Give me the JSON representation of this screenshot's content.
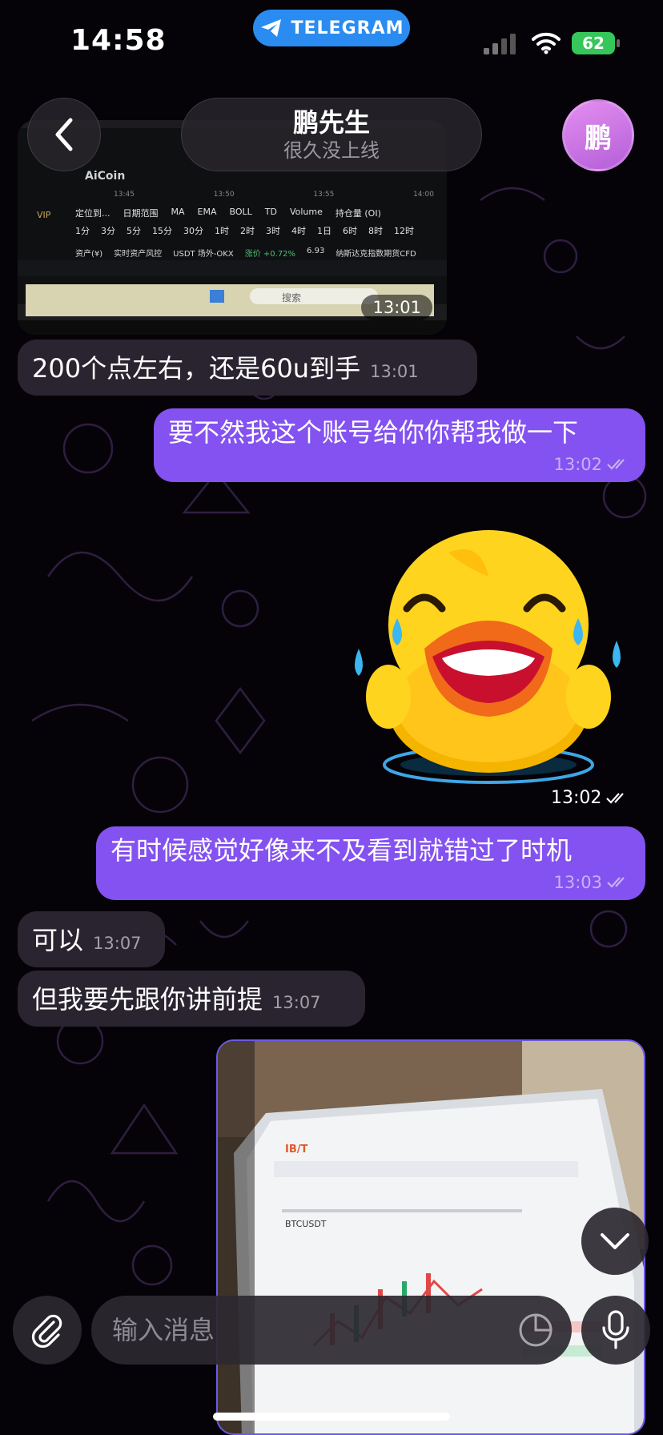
{
  "status_bar": {
    "time": "14:58",
    "app_pill": "TELEGRAM",
    "battery": "62"
  },
  "header": {
    "contact_name": "鹏先生",
    "contact_status": "很久没上线",
    "avatar_initial": "鹏"
  },
  "photo_top": {
    "time": "13:01",
    "screen": {
      "brand": "AiCoin",
      "vip": "VIP",
      "times": [
        "13:45",
        "13:50",
        "13:55",
        "14:00"
      ],
      "toolbar": [
        "定位到...",
        "日期范围",
        "MA",
        "EMA",
        "BOLL",
        "TD",
        "Volume",
        "持仓量 (OI)"
      ],
      "intervals": [
        "1分",
        "3分",
        "5分",
        "15分",
        "30分",
        "1时",
        "2时",
        "3时",
        "4时",
        "1日",
        "6时",
        "8时",
        "12时"
      ],
      "bottom_row": [
        "资产(¥)",
        "实时资产风控",
        "USDT 场外-OKX",
        "涨价 +0.72%",
        "6.93",
        "纳斯达克指数期货CFD"
      ],
      "search": "搜索"
    }
  },
  "messages": [
    {
      "id": "m1",
      "direction": "in",
      "text": "200个点左右，还是60u到手",
      "time": "13:01"
    },
    {
      "id": "m2",
      "direction": "out",
      "text": "要不然我这个账号给你你帮我做一下",
      "time": "13:02"
    },
    {
      "id": "m3",
      "direction": "out",
      "text": "有时候感觉好像来不及看到就错过了时机",
      "time": "13:03"
    },
    {
      "id": "m4",
      "direction": "in",
      "text": "可以",
      "time": "13:07"
    },
    {
      "id": "m5",
      "direction": "in",
      "text": "但我要先跟你讲前提",
      "time": "13:07"
    }
  ],
  "sticker": {
    "time": "13:02",
    "emoji": "laughing-duck"
  },
  "photo_bottom": {
    "screen": {
      "brand": "IB/T",
      "pair": "BTCUSDT"
    }
  },
  "input": {
    "placeholder": "输入消息"
  },
  "colors": {
    "outgoing": "#8452f0",
    "incoming": "#2a2430",
    "telegram": "#2a8cf0",
    "battery": "#35c759"
  }
}
